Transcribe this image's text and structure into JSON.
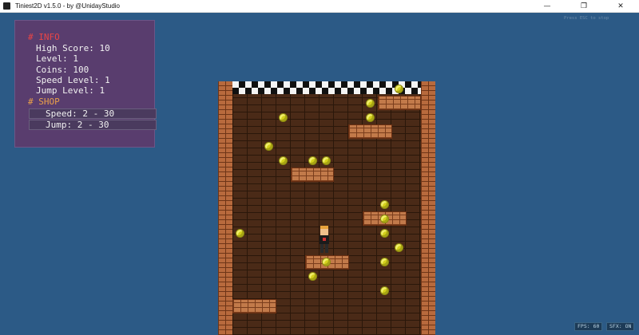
{
  "window": {
    "title": "Tiniest2D v1.5.0 - by @UnidayStudio",
    "controls": {
      "minimize": "—",
      "maximize": "❐",
      "close": "✕"
    }
  },
  "info_panel": {
    "info_header": "# INFO",
    "high_score": "High Score: 10",
    "level": "Level: 1",
    "coins": "Coins: 100",
    "speed_level": "Speed Level: 1",
    "jump_level": "Jump Level: 1",
    "shop_header": "# SHOP",
    "shop_items": [
      {
        "label": "Speed: 2 - 30"
      },
      {
        "label": "Jump: 2 - 30"
      }
    ]
  },
  "hints": {
    "esc": "Press ESC to stop",
    "fps": "FPS: 60",
    "sfx": "SFX: ON"
  },
  "colors": {
    "background": "#2c5a86",
    "panel": "#593d6e",
    "info_header": "#ea4545",
    "shop_header": "#eaa04a",
    "coin": "#d4d21c",
    "brick": "#c27a4a"
  }
}
